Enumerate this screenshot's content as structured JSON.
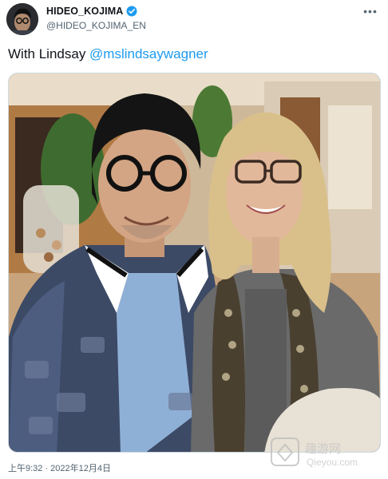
{
  "author": {
    "display_name": "HIDEO_KOJIMA",
    "handle": "@HIDEO_KOJIMA_EN",
    "verified_icon": "verified-badge-icon",
    "avatar_icon": "avatar"
  },
  "menu": {
    "more_label": "•••"
  },
  "tweet": {
    "text_prefix": "With Lindsay ",
    "mention": "@mslindsaywagner",
    "timestamp": "上午9:32 · 2022年12月4日"
  },
  "photo": {
    "alt": "Photo of two people smiling at an indoor event"
  },
  "watermark": {
    "brand_label": "趣游网",
    "site_label": "Qieyou.com"
  },
  "colors": {
    "accent": "#1d9bf0",
    "muted": "#536471",
    "text": "#0f1419"
  }
}
